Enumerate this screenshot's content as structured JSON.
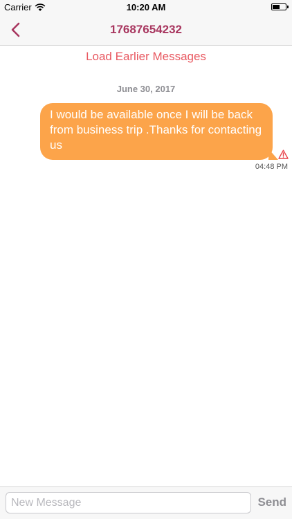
{
  "status_bar": {
    "carrier": "Carrier",
    "time": "10:20 AM",
    "battery_level": 0.55
  },
  "nav": {
    "title": "17687654232",
    "back_icon": "chevron-left-icon",
    "accent_color": "#a8365f"
  },
  "chat": {
    "load_earlier_label": "Load Earlier Messages",
    "date_label": "June 30, 2017",
    "messages": [
      {
        "text": "I would be available once I will be back from business trip .Thanks for contacting us",
        "time": "04:48 PM",
        "status": "failed",
        "status_icon": "warning-icon",
        "bubble_color": "#fca44a"
      }
    ]
  },
  "input_toolbar": {
    "placeholder": "New Message",
    "value": "",
    "send_label": "Send"
  }
}
